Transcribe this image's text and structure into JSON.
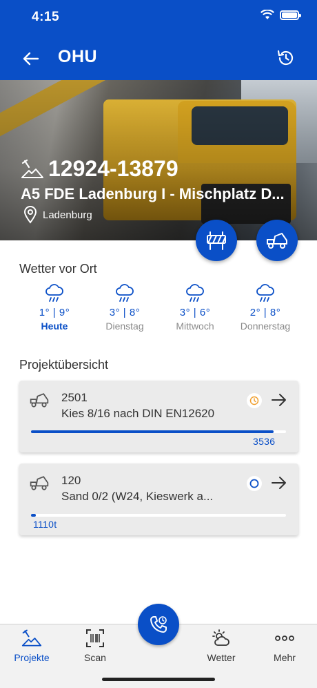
{
  "status_bar": {
    "time": "4:15"
  },
  "header": {
    "brand": "OHU"
  },
  "hero": {
    "project_id": "12924-13879",
    "title": "A5 FDE Ladenburg I - Mischplatz D...",
    "location": "Ladenburg"
  },
  "weather": {
    "title": "Wetter vor Ort",
    "days": [
      {
        "temp": "1° | 9°",
        "name": "Heute"
      },
      {
        "temp": "3° | 8°",
        "name": "Dienstag"
      },
      {
        "temp": "3° | 6°",
        "name": "Mittwoch"
      },
      {
        "temp": "2° | 8°",
        "name": "Donnerstag"
      }
    ]
  },
  "overview": {
    "title": "Projektübersicht",
    "items": [
      {
        "number": "2501",
        "description": "Kies 8/16 nach DIN EN12620",
        "quantity": "3536",
        "progress": 0.95,
        "status_icon": "clock-icon",
        "status_color": "#f0a030"
      },
      {
        "number": "120",
        "description": "Sand 0/2 (W24, Kieswerk a...",
        "quantity": "1110t",
        "progress": 0.02,
        "status_icon": "circle-icon",
        "status_color": "#0a4fc7"
      }
    ]
  },
  "tabbar": {
    "projects": "Projekte",
    "scan": "Scan",
    "weather": "Wetter",
    "more": "Mehr"
  },
  "colors": {
    "primary": "#0a4fc7",
    "background": "#ffffff",
    "card": "#ebebeb"
  }
}
